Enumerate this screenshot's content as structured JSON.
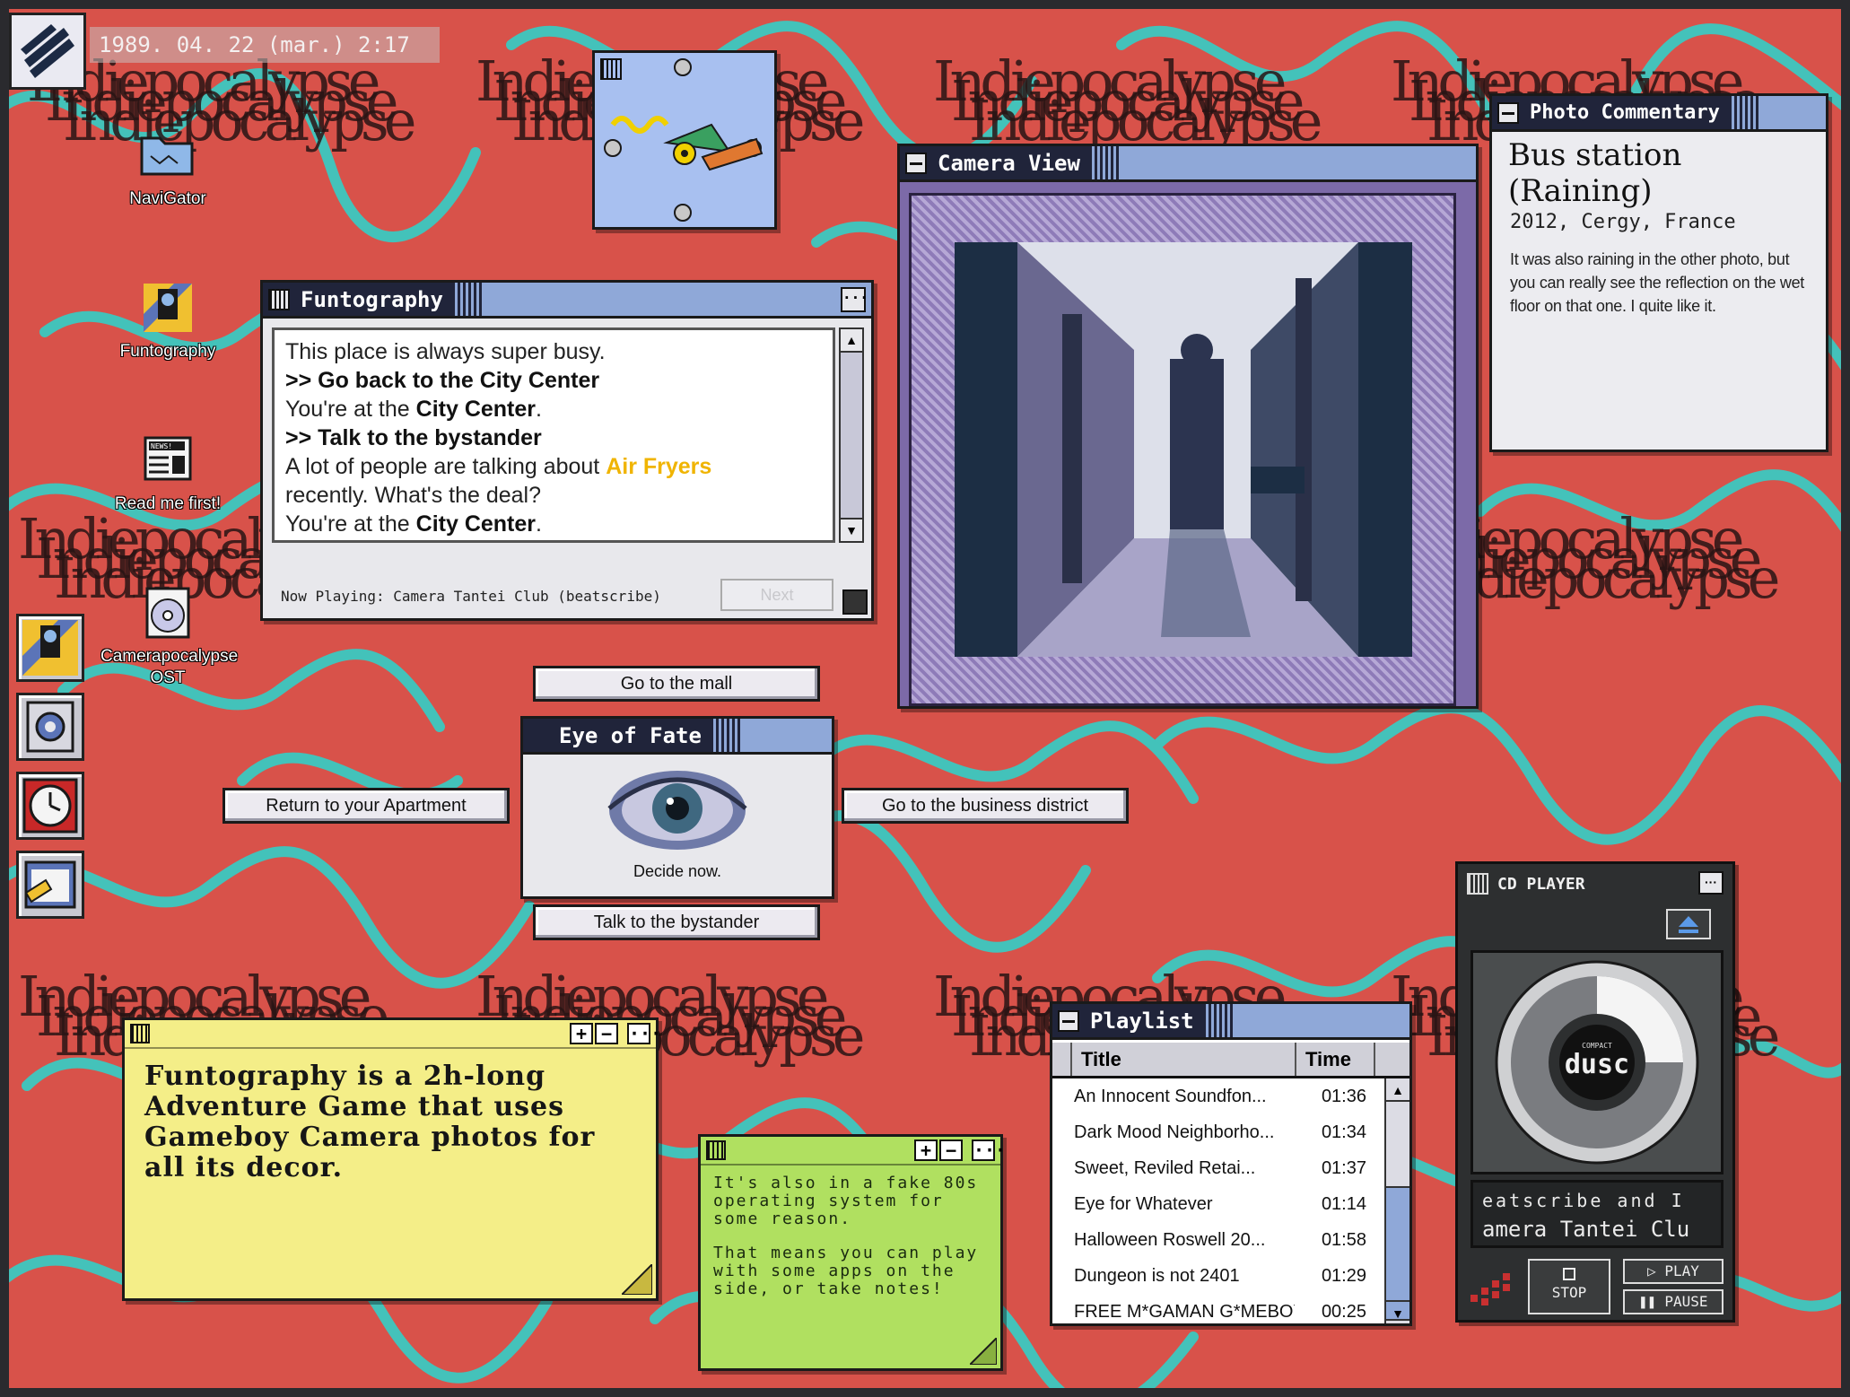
{
  "clock": "1989. 04. 22 (mar.) 2:17",
  "desktop_icons": {
    "navigator": "NaviGator",
    "funtography": "Funtography",
    "readme": "Read me first!",
    "readme_badge": "NEWS!",
    "ost": "Camerapocalypse OST"
  },
  "watermark": "Indiepocalypse",
  "funtography_window": {
    "title": "Funtography",
    "lines": [
      {
        "pre": "This place is always super busy.",
        "b": "",
        "mid": "",
        "y": "",
        "post": ""
      },
      {
        "pre": "",
        "b": ">> Go back to the City Center",
        "mid": "",
        "y": "",
        "post": ""
      },
      {
        "pre": "You're at the ",
        "b": "City Center",
        "mid": ".",
        "y": "",
        "post": ""
      },
      {
        "pre": "",
        "b": ">> Talk to the bystander",
        "mid": "",
        "y": "",
        "post": ""
      },
      {
        "pre": "A lot of people are talking about ",
        "b": "",
        "mid": "",
        "y": "Air Fryers",
        "post": ""
      },
      {
        "pre": "recently. What's the deal?",
        "b": "",
        "mid": "",
        "y": "",
        "post": ""
      },
      {
        "pre": "You're at the ",
        "b": "City Center",
        "mid": ".",
        "y": "",
        "post": ""
      }
    ],
    "now_playing": "Now Playing: Camera Tantei Club (beatscribe)",
    "next_label": "Next",
    "menu_glyph": "···"
  },
  "choices": {
    "mall": "Go to the mall",
    "apartment": "Return to your Apartment",
    "business": "Go to the business district",
    "bystander": "Talk to the bystander"
  },
  "eye_window": {
    "title": "Eye of Fate",
    "caption": "Decide now."
  },
  "camera_window": {
    "title": "Camera View"
  },
  "photo_commentary": {
    "title": "Photo Commentary",
    "photo_title": "Bus station (Raining)",
    "subtitle": "2012, Cergy, France",
    "body": "It was also raining in the other photo, but you can really see the reflection on the wet floor on that one. I quite like it."
  },
  "note_yellow": {
    "text": "Funtography is a 2h-long Adventure Game that uses Gameboy Camera photos for all its decor.",
    "plus": "+",
    "minus": "−",
    "menu": "···"
  },
  "note_green": {
    "p1": "It's also in a fake 80s operating system for some reason.",
    "p2": "That means you can play with some apps on the side, or take notes!",
    "plus": "+",
    "minus": "−",
    "menu": "···"
  },
  "playlist": {
    "title": "Playlist",
    "col_title": "Title",
    "col_time": "Time",
    "rows": [
      {
        "title": "An Innocent Soundfon...",
        "time": "01:36"
      },
      {
        "title": "Dark Mood Neighborho...",
        "time": "01:34"
      },
      {
        "title": "Sweet, Reviled Retai...",
        "time": "01:37"
      },
      {
        "title": "Eye for Whatever",
        "time": "01:14"
      },
      {
        "title": "Halloween Roswell 20...",
        "time": "01:58"
      },
      {
        "title": "Dungeon is not 2401",
        "time": "01:29"
      },
      {
        "title": "FREE M*GAMAN G*MEBOY...",
        "time": "00:25"
      }
    ]
  },
  "cd_player": {
    "title": "CD PLAYER",
    "disc_label_small": "COMPACT",
    "disc_label": "dusc",
    "display_line1": "eatscribe and I",
    "display_line2": "amera Tantei Clu",
    "stop": "STOP",
    "play": "PLAY",
    "pause": "PAUSE",
    "menu": "···"
  },
  "colors": {
    "desktop": "#d8524a",
    "squiggle": "#3cc8c0",
    "titlebar": "#8fa8d8",
    "titlebar_dark": "#20243a",
    "note_yellow": "#f4ee88",
    "note_green": "#b0e060",
    "accent_yellow": "#f0b400"
  }
}
